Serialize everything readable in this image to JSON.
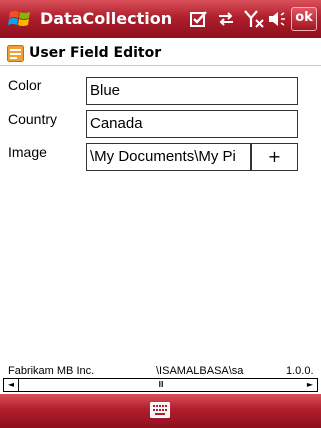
{
  "window": {
    "title": "DataCollection",
    "ok_label": "ok",
    "status_icons": [
      "edit-check-icon",
      "sync-arrows-icon",
      "signal-off-icon",
      "speaker-icon"
    ]
  },
  "header": {
    "icon": "app-form-icon",
    "title": "User Field Editor"
  },
  "fields": [
    {
      "label": "Color",
      "value": "Blue"
    },
    {
      "label": "Country",
      "value": "Canada"
    },
    {
      "label": "Image",
      "value": "\\My Documents\\My Pi",
      "button_label": "+"
    }
  ],
  "status_row": {
    "company": "Fabrikam MB Inc.",
    "user": "\\ISAMALBASA\\sa",
    "version": "1.0.0."
  },
  "scrollbar": {
    "left_arrow": "◄",
    "thumb_grip": "Ⅲ",
    "right_arrow": "►"
  },
  "softkey": {
    "center_icon": "keyboard-icon"
  },
  "colors": {
    "bar_top": "#d9505a",
    "bar_bottom": "#8e0f1d",
    "accent_orange": "#f0a030"
  }
}
